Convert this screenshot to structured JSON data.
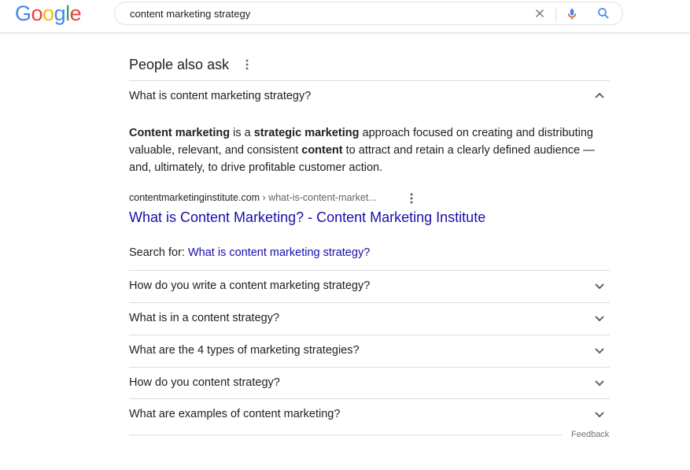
{
  "header": {
    "logo_letters": [
      "G",
      "o",
      "o",
      "g",
      "l",
      "e"
    ],
    "logo_colors": [
      "#4285F4",
      "#EA4335",
      "#FBBC05",
      "#4285F4",
      "#34A853",
      "#EA4335"
    ],
    "search_query": "content marketing strategy",
    "icons": {
      "clear": "close-icon",
      "voice": "mic-icon",
      "search": "search-icon"
    }
  },
  "paa": {
    "title": "People also ask",
    "expanded": {
      "question": "What is content marketing strategy?",
      "answer_parts": [
        {
          "text": "Content marketing",
          "bold": true
        },
        {
          "text": " is a ",
          "bold": false
        },
        {
          "text": "strategic marketing",
          "bold": true
        },
        {
          "text": " approach focused on creating and distributing valuable, relevant, and consistent ",
          "bold": false
        },
        {
          "text": "content",
          "bold": true
        },
        {
          "text": " to attract and retain a clearly defined audience — and, ultimately, to drive profitable customer action.",
          "bold": false
        }
      ],
      "cite_domain": "contentmarketinginstitute.com",
      "cite_path": " › what-is-content-market...",
      "link_title": "What is Content Marketing? - Content Marketing Institute",
      "search_for_label": "Search for: ",
      "search_for_link": "What is content marketing strategy?"
    },
    "questions": [
      "How do you write a content marketing strategy?",
      "What is in a content strategy?",
      "What are the 4 types of marketing strategies?",
      "How do you content strategy?",
      "What are examples of content marketing?"
    ],
    "feedback": "Feedback"
  },
  "colors": {
    "link": "#1a0dab",
    "text": "#202124",
    "muted": "#70757a",
    "divider": "#dadce0"
  }
}
